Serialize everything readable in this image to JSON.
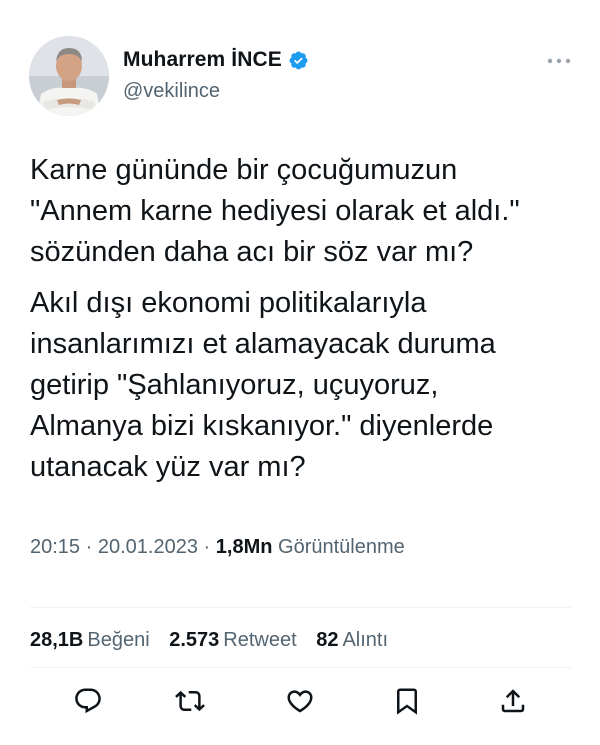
{
  "author": {
    "display_name": "Muharrem İNCE",
    "handle": "@vekilince",
    "verified": true
  },
  "tweet": {
    "paragraphs": [
      "Karne gününde bir çocuğumuzun\n\"Annem karne hediyesi olarak et aldı.\"\nsözünden daha acı bir söz var mı?",
      "Akıl dışı ekonomi politikalarıyla\ninsanlarımızı et alamayacak duruma\ngetirip \"Şahlanıyoruz, uçuyoruz,\nAlmanya bizi kıskanıyor.\" diyenlerde\nutanacak yüz var mı?"
    ]
  },
  "meta": {
    "time": "20:15",
    "separator": "·",
    "date": "20.01.2023",
    "views_count": "1,8Mn",
    "views_label": "Görüntülenme"
  },
  "stats": {
    "likes": {
      "count": "28,1B",
      "label": "Beğeni"
    },
    "retweets": {
      "count": "2.573",
      "label": "Retweet"
    },
    "quotes": {
      "count": "82",
      "label": "Alıntı"
    }
  },
  "actions": [
    "reply-icon",
    "retweet-icon",
    "like-icon",
    "bookmark-icon",
    "share-icon"
  ],
  "colors": {
    "text": "#0f1419",
    "secondary": "#536471",
    "verified": "#1d9bf0",
    "divider": "#eff3f4"
  }
}
